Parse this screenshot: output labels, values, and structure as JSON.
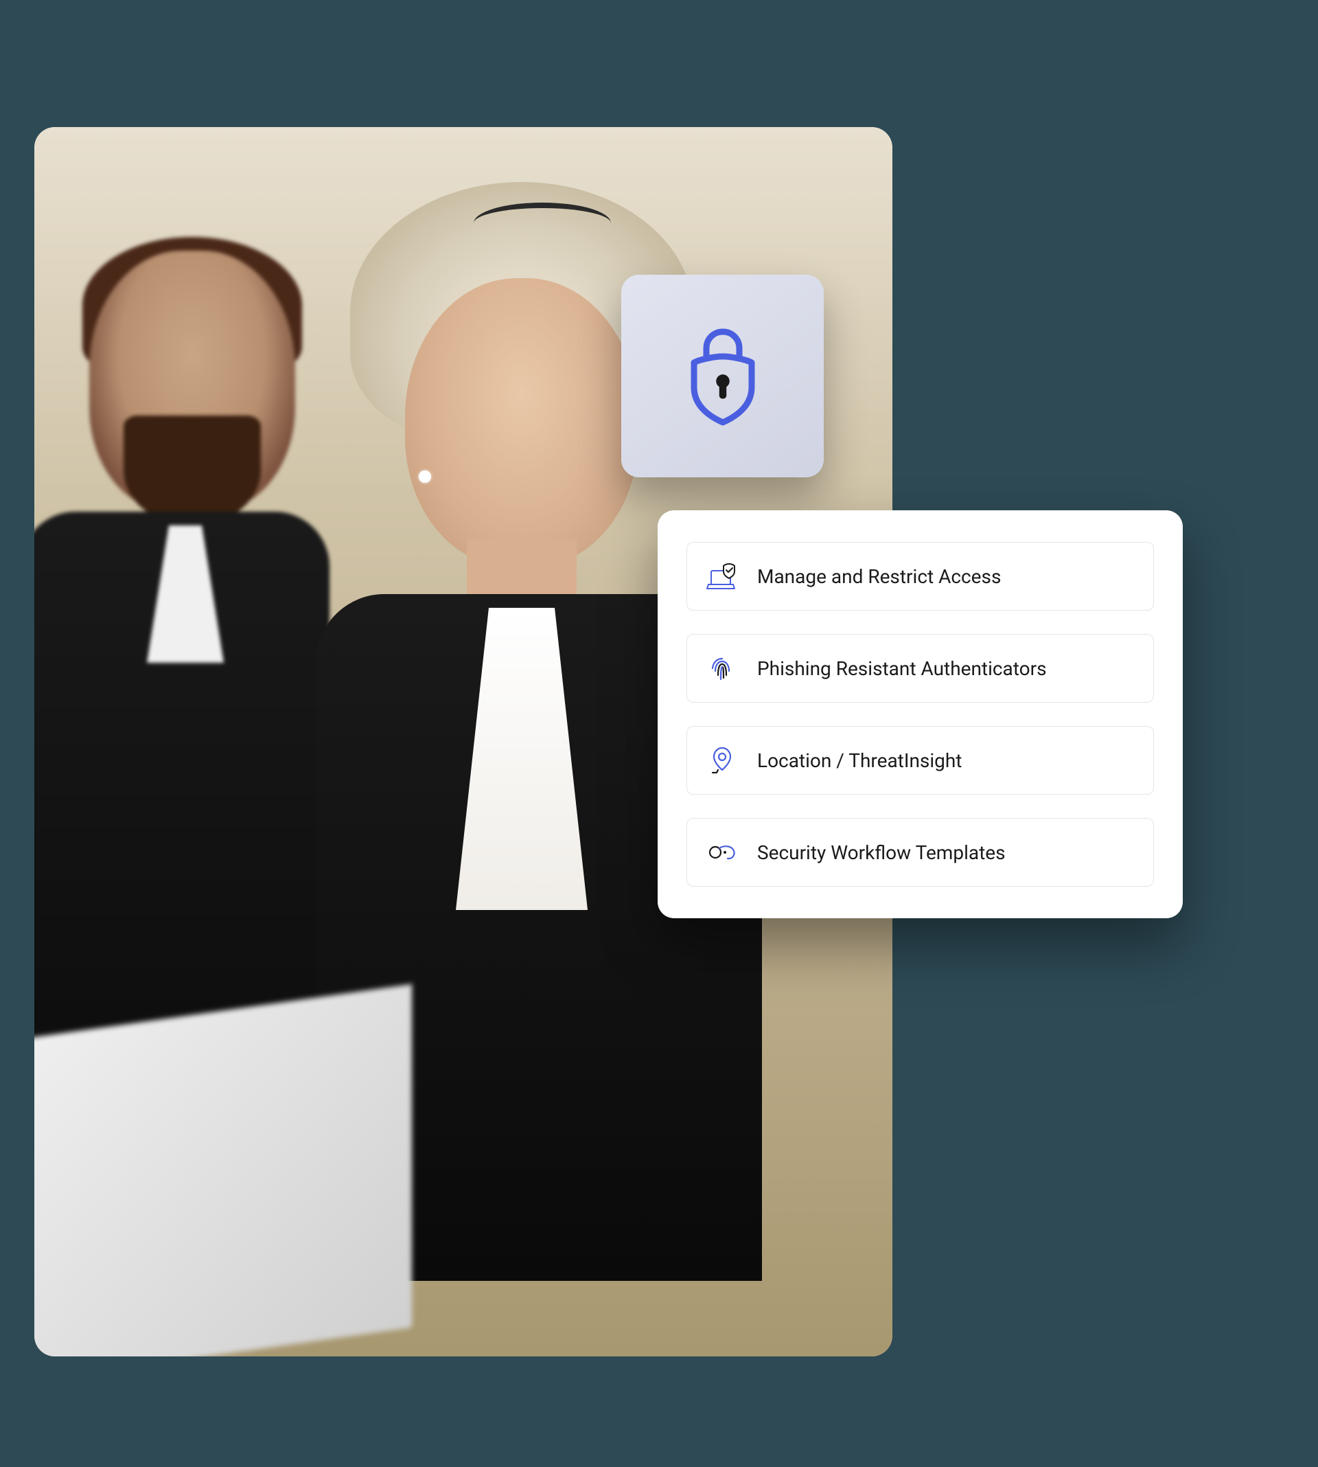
{
  "features": {
    "items": [
      {
        "label": "Manage and Restrict Access",
        "icon": "laptop-shield-icon"
      },
      {
        "label": "Phishing Resistant Authenticators",
        "icon": "fingerprint-icon"
      },
      {
        "label": "Location / ThreatInsight",
        "icon": "location-pin-icon"
      },
      {
        "label": "Security Workflow Templates",
        "icon": "workflow-link-icon"
      }
    ]
  },
  "hero": {
    "main_icon": "lock-shield-icon"
  },
  "colors": {
    "background": "#2d4a55",
    "accent": "#4a5fe0",
    "card_bg": "#ffffff",
    "lock_card_bg": "#e2e4f0",
    "border": "#e5e5e5",
    "text": "#1a1a1a"
  }
}
